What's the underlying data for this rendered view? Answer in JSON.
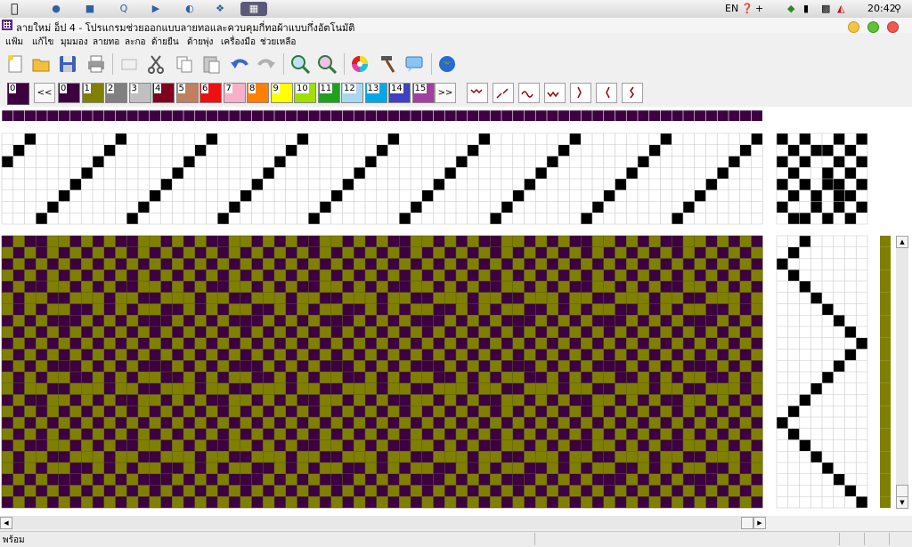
{
  "system_bar": {
    "lang": "EN",
    "clock": "20:42"
  },
  "window": {
    "title": "ลายใหม่ อ็ป 4 - โปรแกรมช่วยออกแบบลายทอและควบคุมกี่ทอผ้าแบบกึ่งอัตโนมัติ"
  },
  "menu": [
    {
      "label": "แฟ้ม"
    },
    {
      "label": "แก้ไข"
    },
    {
      "label": "มุมมอง"
    },
    {
      "label": "ลายทอ"
    },
    {
      "label": "ละกอ"
    },
    {
      "label": "ด้ายยืน"
    },
    {
      "label": "ด้ายพุ่ง"
    },
    {
      "label": "เครื่องมือ"
    },
    {
      "label": "ช่วยเหลือ"
    }
  ],
  "toolbar_icons": [
    "new-file-icon",
    "open-folder-icon",
    "save-icon",
    "print-icon",
    "select-rect-icon",
    "cut-icon",
    "copy-icon",
    "paste-icon",
    "undo-icon",
    "redo-icon",
    "zoom-in-icon",
    "zoom-out-icon",
    "color-wheel-icon",
    "hammer-icon",
    "comment-icon",
    "globe-icon"
  ],
  "palette": {
    "current": {
      "label": "0",
      "color": "#3d0040"
    },
    "prev_label": "<<",
    "next_label": ">>",
    "swatches": [
      {
        "label": "0",
        "color": "#3d0040"
      },
      {
        "label": "1",
        "color": "#808000"
      },
      {
        "label": "2",
        "color": "#808080"
      },
      {
        "label": "3",
        "color": "#c0c0c0"
      },
      {
        "label": "4",
        "color": "#800020"
      },
      {
        "label": "5",
        "color": "#c08060"
      },
      {
        "label": "6",
        "color": "#ee1010"
      },
      {
        "label": "7",
        "color": "#f8b0c8"
      },
      {
        "label": "8",
        "color": "#ff8000"
      },
      {
        "label": "9",
        "color": "#ffff00"
      },
      {
        "label": "10",
        "color": "#a0e000"
      },
      {
        "label": "11",
        "color": "#20a020"
      },
      {
        "label": "12",
        "color": "#a8d8f0"
      },
      {
        "label": "13",
        "color": "#00a8e8"
      },
      {
        "label": "14",
        "color": "#4040c0"
      },
      {
        "label": "15",
        "color": "#a040a0"
      }
    ],
    "twill_tools": [
      "twill-left-icon",
      "twill-right-icon",
      "wave-icon",
      "zigzag-icon",
      "steep-right-icon",
      "steep-left-icon",
      "zigzag-vertical-icon"
    ]
  },
  "colors": {
    "warp": "#3d0040",
    "weft": "#808000"
  },
  "status": {
    "text": "พร้อม"
  }
}
